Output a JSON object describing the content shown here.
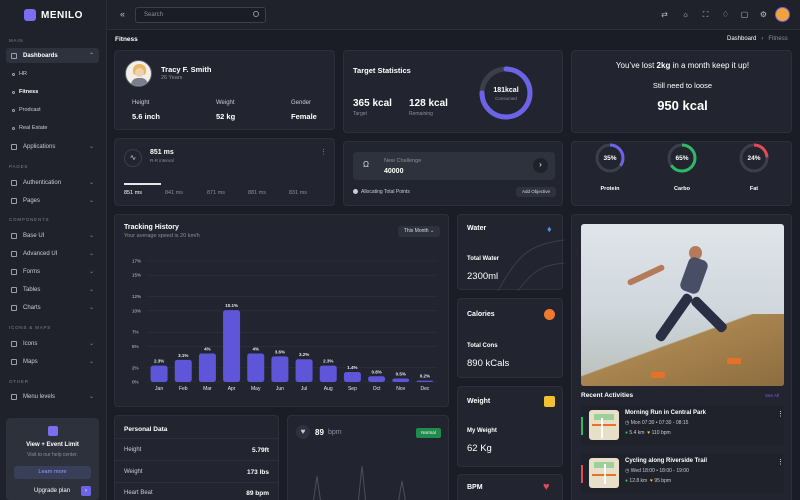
{
  "brand": {
    "name": "MENILO"
  },
  "sidebar": {
    "sections": {
      "main": "MAIN",
      "pages": "PAGES",
      "components": "COMPONENTS",
      "icons_maps": "ICONS & MAPS",
      "other": "OTHER"
    },
    "dashboards": "Dashboards",
    "dash_items": [
      "HR",
      "Fitness",
      "Prodcast",
      "Real Estate"
    ],
    "applications": "Applications",
    "authentication": "Authentication",
    "pages": "Pages",
    "base_ui": "Base UI",
    "advanced_ui": "Advanced UI",
    "forms": "Forms",
    "tables": "Tables",
    "charts": "Charts",
    "icons": "Icons",
    "maps": "Maps",
    "menu_levels": "Menu levels",
    "promo": {
      "title": "View + Event Limit",
      "subtitle": "Visit to our help center.",
      "learn_more": "Learn more",
      "upgrade": "Upgrade plan"
    }
  },
  "header": {
    "search_placeholder": "Search"
  },
  "page": {
    "title": "Fitness",
    "breadcrumb": [
      "Dashboard",
      "Fitness"
    ]
  },
  "profile": {
    "name": "Tracy F. Smith",
    "age": "26 Years",
    "height_label": "Height",
    "height": "5.6 inch",
    "weight_label": "Weight",
    "weight": "52 kg",
    "gender_label": "Gender",
    "gender": "Female"
  },
  "rr": {
    "value": "851 ms",
    "label": "R-R interval",
    "ticks": [
      "851 ms",
      "841 ms",
      "871 ms",
      "881 ms",
      "831 ms"
    ]
  },
  "target": {
    "title": "Target Statistics",
    "target_value": "365 kcal",
    "target_label": "Target",
    "remaining_value": "128 kcal",
    "remaining_label": "Remaining",
    "ring_value": "181kcal",
    "ring_label": "Consumed",
    "ring_fraction": 0.75
  },
  "challenge": {
    "title": "New Challenge",
    "value": "40000",
    "allocating": "Allocating Total Points",
    "add_objective": "Add Objective"
  },
  "lost": {
    "line1_pre": "You’ve lost ",
    "line1_bold": "2kg",
    "line1_post": " in a month keep it up!",
    "line2": "Still need to loose",
    "big": "950 kcal",
    "rings": [
      {
        "pct": "35%",
        "label": "Protein",
        "value": 35,
        "color": "#6c63e8"
      },
      {
        "pct": "65%",
        "label": "Carbo",
        "value": 65,
        "color": "#2fb866"
      },
      {
        "pct": "24%",
        "label": "Fat",
        "value": 24,
        "color": "#e24a55"
      }
    ]
  },
  "tracking": {
    "title": "Tracking History",
    "subtitle": "Your average speed is 20 km/h",
    "dropdown": "This Month"
  },
  "chart_data": {
    "type": "bar",
    "categories": [
      "Jan",
      "Feb",
      "Mar",
      "Apr",
      "May",
      "Jun",
      "Jul",
      "Aug",
      "Sep",
      "Oct",
      "Nov",
      "Dec"
    ],
    "values": [
      2.3,
      3.1,
      4,
      10.1,
      4,
      3.6,
      3.2,
      2.3,
      1.4,
      0.8,
      0.5,
      0.2
    ],
    "data_labels": [
      "2.3%",
      "3.1%",
      "4%",
      "10.1%",
      "4%",
      "3.6%",
      "3.2%",
      "2.3%",
      "1.4%",
      "0.8%",
      "0.5%",
      "0.2%"
    ],
    "yticks": [
      "17%",
      "15%",
      "12%",
      "10%",
      "7%",
      "5%",
      "2%",
      "0%"
    ],
    "ylim": [
      0,
      17
    ],
    "grid": true,
    "color": "#5f55d9"
  },
  "water": {
    "title": "Water",
    "label": "Total Water",
    "value": "2300ml"
  },
  "calories": {
    "title": "Calories",
    "label": "Total Cons",
    "value": "890 kCals"
  },
  "weight": {
    "title": "Weight",
    "label": "My Weight",
    "value": "62 Kg"
  },
  "bpm_card": {
    "title": "BPM"
  },
  "personal": {
    "title": "Personal Data",
    "rows": [
      {
        "label": "Height",
        "value": "5.79ft"
      },
      {
        "label": "Weight",
        "value": "173 lbs"
      },
      {
        "label": "Heart Beat",
        "value": "89 bpm"
      }
    ]
  },
  "heart": {
    "value": "89",
    "unit": "bpm",
    "badge": "Normal"
  },
  "activities": {
    "title": "Recent Activities",
    "see_all": "See All",
    "items": [
      {
        "title": "Morning Run in Central Park",
        "time": "Mon 07:30 • 07:30 - 08:15",
        "distance": "5.4 km",
        "heart": "110 bpm",
        "accent": "#2fb866"
      },
      {
        "title": "Cycling along Riverside Trail",
        "time": "Wed 18:00 • 18:00 - 19:00",
        "distance": "12.8 km",
        "heart": "95 bpm",
        "accent": "#e24a55"
      }
    ]
  }
}
